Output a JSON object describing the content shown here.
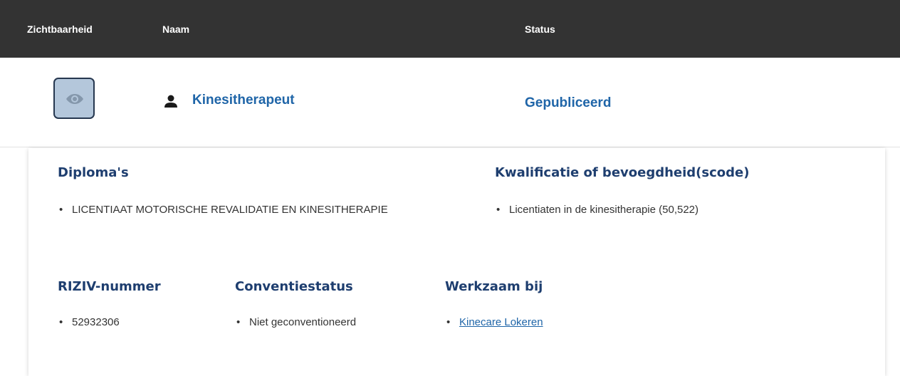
{
  "table_header": {
    "visibility": "Zichtbaarheid",
    "name": "Naam",
    "status": "Status"
  },
  "row": {
    "visibility_icon": "eye-icon",
    "person_icon": "person-icon",
    "name": "Kinesitherapeut",
    "status": "Gepubliceerd"
  },
  "details": {
    "diplomas": {
      "title": "Diploma's",
      "items": [
        "LICENTIAAT MOTORISCHE REVALIDATIE EN KINESITHERAPIE"
      ]
    },
    "qualification": {
      "title": "Kwalificatie of bevoegdheid(scode)",
      "items": [
        "Licentiaten in de kinesitherapie (50,522)"
      ]
    },
    "riziv": {
      "title": "RIZIV-nummer",
      "items": [
        "52932306"
      ]
    },
    "convention": {
      "title": "Conventiestatus",
      "items": [
        "Niet geconventioneerd"
      ]
    },
    "works_at": {
      "title": "Werkzaam bij",
      "items": [
        "Kinecare Lokeren"
      ]
    }
  },
  "colors": {
    "header_bg": "#333333",
    "accent_blue": "#1f65a8",
    "heading_navy": "#1e3e6f",
    "eye_button_bg": "#b4c7db"
  }
}
